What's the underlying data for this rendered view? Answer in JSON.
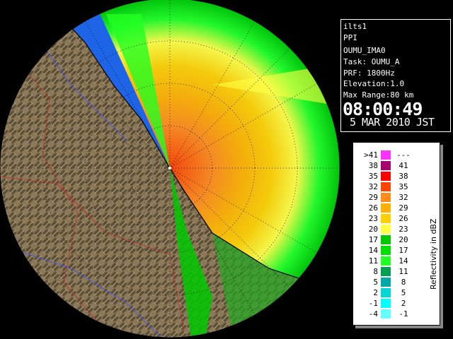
{
  "info": {
    "site": "ilts1",
    "product": "PPI",
    "scan": "OUMU_IMA0",
    "task": "Task: OUMU_A",
    "prf": "PRF: 1800Hz",
    "elevation": "Elevation:1.0",
    "max_range": "Max Range:80 km",
    "time": "08:00:49",
    "date": "5 MAR 2010 JST"
  },
  "legend": {
    "units": "Reflectivity in dBZ",
    "rows": [
      {
        "low": ">41",
        "high": "---",
        "color": "#ff33ff"
      },
      {
        "low": "38",
        "high": "41",
        "color": "#a8006e"
      },
      {
        "low": "35",
        "high": "38",
        "color": "#ff0000"
      },
      {
        "low": "32",
        "high": "35",
        "color": "#ff4400"
      },
      {
        "low": "29",
        "high": "32",
        "color": "#ff8c1a"
      },
      {
        "low": "26",
        "high": "29",
        "color": "#ffb000"
      },
      {
        "low": "23",
        "high": "26",
        "color": "#ffd000"
      },
      {
        "low": "20",
        "high": "23",
        "color": "#ffff44"
      },
      {
        "low": "17",
        "high": "20",
        "color": "#00c800"
      },
      {
        "low": "14",
        "high": "17",
        "color": "#00e000"
      },
      {
        "low": "11",
        "high": "14",
        "color": "#22ff22"
      },
      {
        "low": "8",
        "high": "11",
        "color": "#00a050"
      },
      {
        "low": "5",
        "high": "8",
        "color": "#00a8a8"
      },
      {
        "low": "2",
        "high": "5",
        "color": "#00d8d8"
      },
      {
        "low": "-1",
        "high": "2",
        "color": "#00ffff"
      },
      {
        "low": "-4",
        "high": "-1",
        "color": "#66ffff"
      }
    ]
  },
  "colors": {
    "ocean": "#1e64e6",
    "land": "#7a6a50",
    "background": "#000000"
  }
}
